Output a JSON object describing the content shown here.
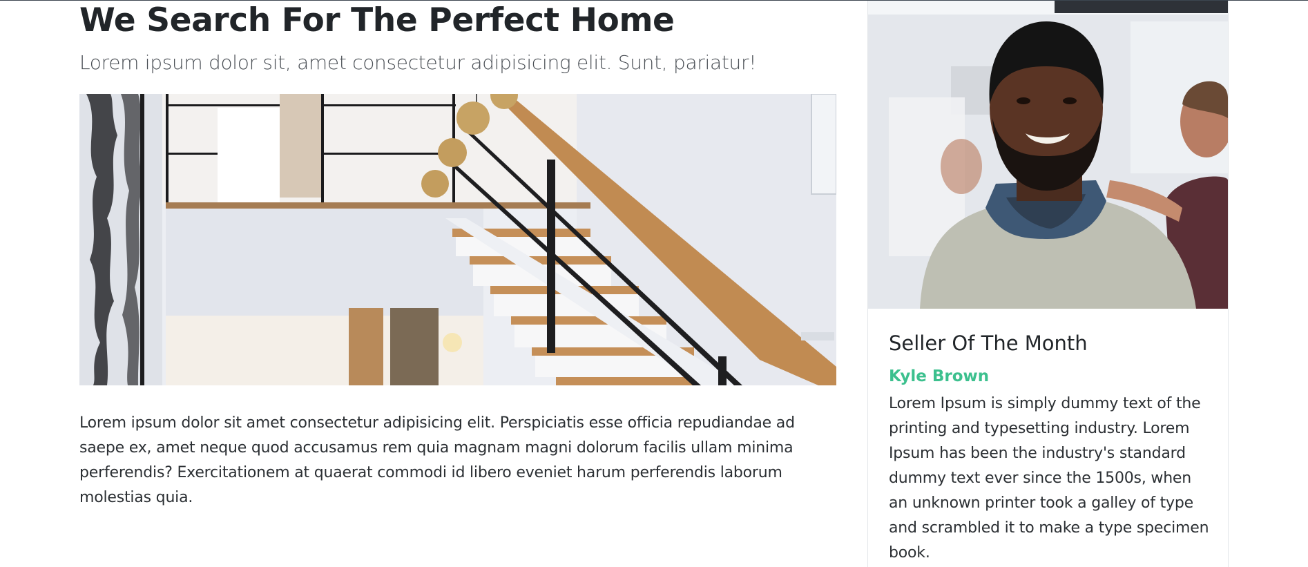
{
  "main": {
    "title": "We Search For The Perfect Home",
    "lead": "Lorem ipsum dolor sit, amet consectetur adipisicing elit. Sunt, pariatur!",
    "paragraph": "Lorem ipsum dolor sit amet consectetur adipisicing elit. Perspiciatis esse officia repudiandae ad saepe ex, amet neque quod accusamus rem quia magnam magni dolorum facilis ullam minima perferendis? Exercitationem at quaerat commodi id libero eveniet harum perferendis laborum molestias quia."
  },
  "seller_card": {
    "title": "Seller Of The Month",
    "name": "Kyle Brown",
    "text": "Lorem Ipsum is simply dummy text of the printing and typesetting industry. Lorem Ipsum has been the industry's standard dummy text ever since the 1500s, when an unknown printer took a galley of type and scrambled it to make a type specimen book."
  },
  "colors": {
    "accent": "#3cc08e",
    "text": "#212529"
  }
}
